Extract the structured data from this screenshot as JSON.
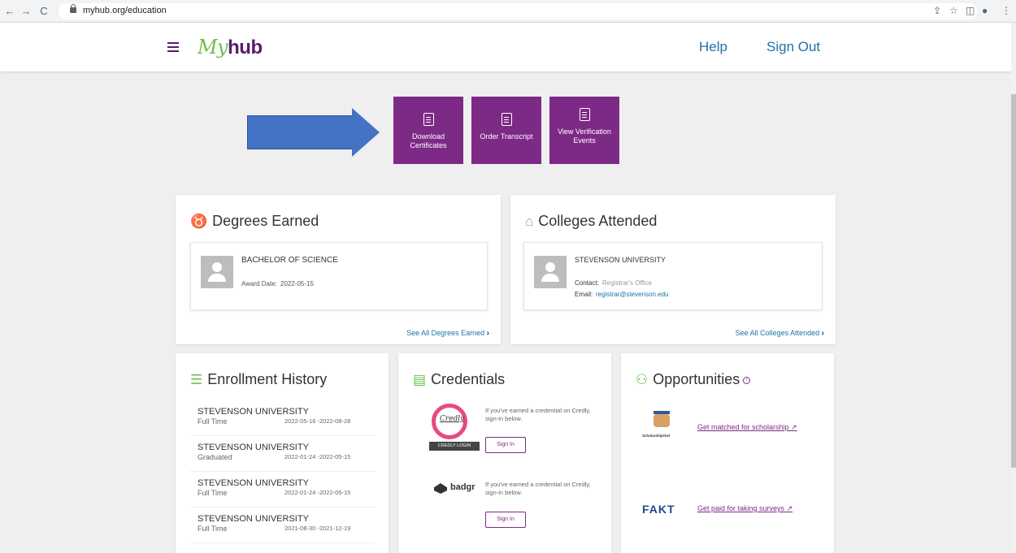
{
  "browser": {
    "back": "←",
    "forward": "→",
    "reload": "C",
    "url": "myhub.org/education",
    "share": "⇪",
    "star": "☆",
    "sidepanel": "◫",
    "profile": "●",
    "menu": "⋮"
  },
  "header": {
    "logo_my": "My",
    "logo_hub": "hub",
    "help": "Help",
    "sign_out": "Sign Out"
  },
  "actions": [
    {
      "label": "Download Certificates"
    },
    {
      "label": "Order Transcript"
    },
    {
      "label": "View Verification Events"
    }
  ],
  "degrees": {
    "title": "Degrees Earned",
    "degree": "BACHELOR OF SCIENCE",
    "award_label": "Award Date:",
    "award_date": "2022-05-15",
    "see_all": "See All Degrees Earned"
  },
  "colleges": {
    "title": "Colleges Attended",
    "college": "STEVENSON UNIVERSITY",
    "contact_label": "Contact:",
    "contact": "Registrar's Office",
    "email_label": "Email:",
    "email": "registrar@stevenson.edu",
    "see_all": "See All Colleges Attended"
  },
  "enrollment": {
    "title": "Enrollment History",
    "rows": [
      {
        "school": "STEVENSON UNIVERSITY",
        "status": "Full Time",
        "dates": "2022-05-16 -2022-08-28"
      },
      {
        "school": "STEVENSON UNIVERSITY",
        "status": "Graduated",
        "dates": "2022-01-24 -2022-05-15"
      },
      {
        "school": "STEVENSON UNIVERSITY",
        "status": "Full Time",
        "dates": "2022-01-24 -2022-05-15"
      },
      {
        "school": "STEVENSON UNIVERSITY",
        "status": "Full Time",
        "dates": "2021-08-30 -2021-12-19"
      }
    ]
  },
  "credentials": {
    "title": "Credentials",
    "credly_word": "Credly",
    "credly_login": "CREDLY LOGIN",
    "credly_text": "If you've earned a credential on Credly, sign-in below.",
    "badgr_word": "badgr",
    "badgr_text": "If you've earned a credential on Credly, sign-in below.",
    "sign_in": "Sign In"
  },
  "opportunities": {
    "title": "Opportunities",
    "info": "i",
    "scholarship_logo": "ScholarshipOwl",
    "scholarship_link": "Get matched for scholarship",
    "fakt_logo": "FAKT",
    "survey_link": "Get paid for taking surveys",
    "ext_icon": "↗"
  },
  "colors": {
    "accent": "#7d2a87",
    "brand_green": "#6abf4b",
    "link": "#1a73a8",
    "arrow": "#4472c4"
  }
}
